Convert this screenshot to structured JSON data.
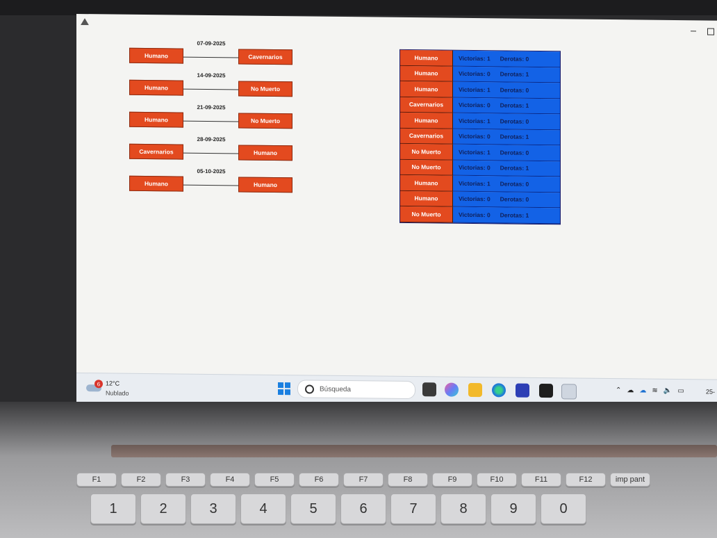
{
  "app": {
    "matches": [
      {
        "date": "07-09-2025",
        "home": "Humano",
        "away": "Cavernarios"
      },
      {
        "date": "14-09-2025",
        "home": "Humano",
        "away": "No Muerto"
      },
      {
        "date": "21-09-2025",
        "home": "Humano",
        "away": "No Muerto"
      },
      {
        "date": "28-09-2025",
        "home": "Cavernarios",
        "away": "Humano"
      },
      {
        "date": "05-10-2025",
        "home": "Humano",
        "away": "Humano"
      }
    ],
    "standings": [
      {
        "team": "Humano",
        "wins": "Victorias: 1",
        "losses": "Derotas: 0"
      },
      {
        "team": "Humano",
        "wins": "Victorias: 0",
        "losses": "Derotas: 1"
      },
      {
        "team": "Humano",
        "wins": "Victorias: 1",
        "losses": "Derotas: 0"
      },
      {
        "team": "Cavernarios",
        "wins": "Victorias: 0",
        "losses": "Derotas: 1"
      },
      {
        "team": "Humano",
        "wins": "Victorias: 1",
        "losses": "Derotas: 0"
      },
      {
        "team": "Cavernarios",
        "wins": "Victorias: 0",
        "losses": "Derotas: 1"
      },
      {
        "team": "No Muerto",
        "wins": "Victorias: 1",
        "losses": "Derotas: 0"
      },
      {
        "team": "No Muerto",
        "wins": "Victorias: 0",
        "losses": "Derotas: 1"
      },
      {
        "team": "Humano",
        "wins": "Victorias: 1",
        "losses": "Derotas: 0"
      },
      {
        "team": "Humano",
        "wins": "Victorias: 0",
        "losses": "Derotas: 0"
      },
      {
        "team": "No Muerto",
        "wins": "Victorias: 0",
        "losses": "Derotas: 1"
      }
    ],
    "colors": {
      "team_cell": "#e34a1f",
      "stats_cell": "#1362e6"
    }
  },
  "taskbar": {
    "weather": {
      "badge": "6",
      "temp": "12°C",
      "desc": "Nublado"
    },
    "search_placeholder": "Búsqueda",
    "clock": "25-"
  },
  "keyboard": {
    "fkeys": [
      "F1",
      "F2",
      "F3",
      "F4",
      "F5",
      "F6",
      "F7",
      "F8",
      "F9",
      "F10",
      "F11",
      "F12",
      "imp pant"
    ],
    "numkeys": [
      "1",
      "2",
      "3",
      "4",
      "5",
      "6",
      "7",
      "8",
      "9",
      "0"
    ]
  }
}
